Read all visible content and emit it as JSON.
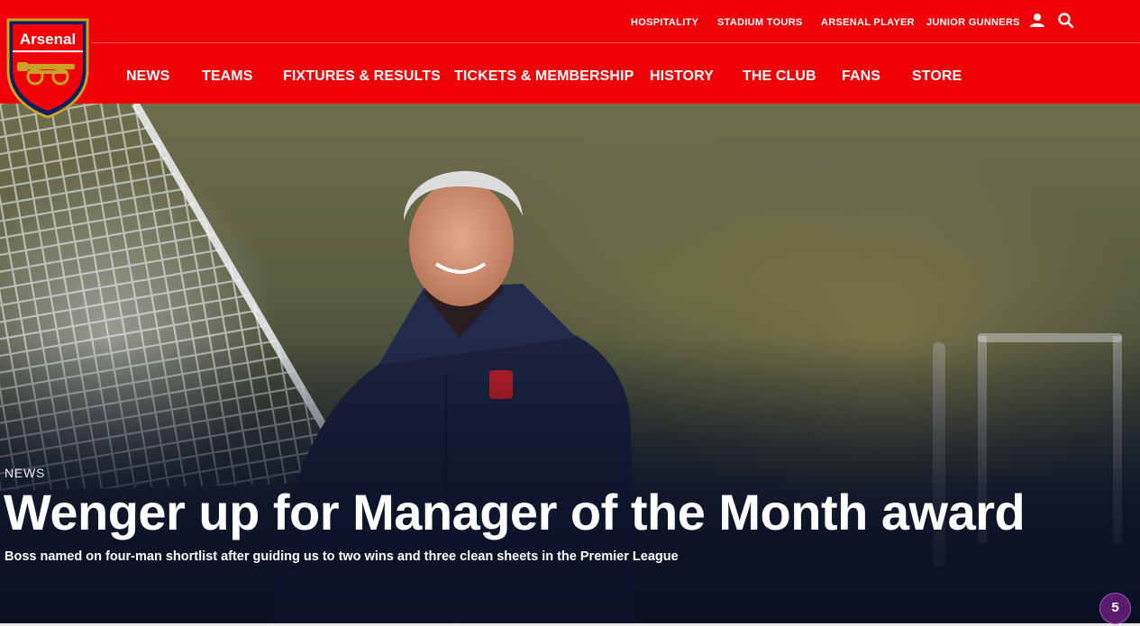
{
  "brand": {
    "name": "Arsenal",
    "primary_color": "#ef0107",
    "navy": "#0d1526"
  },
  "top_links": [
    "HOSPITALITY",
    "STADIUM TOURS",
    "ARSENAL PLAYER",
    "JUNIOR GUNNERS"
  ],
  "top_icons": [
    "user-icon",
    "search-icon"
  ],
  "nav": [
    "NEWS",
    "TEAMS",
    "FIXTURES & RESULTS",
    "TICKETS & MEMBERSHIP",
    "HISTORY",
    "THE CLUB",
    "FANS",
    "STORE"
  ],
  "hero": {
    "kicker": "NEWS",
    "headline": "Wenger up for Manager of the Month award",
    "standfirst": "Boss named on four-man shortlist after guiding us to two wins and three clean sheets in the Premier League"
  },
  "badge": {
    "count": "5",
    "color": "#5a1d6e"
  }
}
